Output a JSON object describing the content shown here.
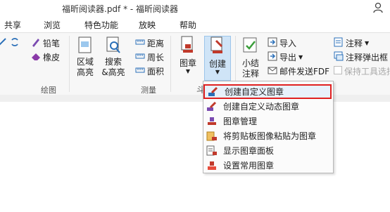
{
  "window": {
    "title": "福昕阅读器.pdf * - 福昕阅读器"
  },
  "menu": {
    "tabs": [
      "共享",
      "浏览",
      "特色功能",
      "放映",
      "帮助"
    ]
  },
  "ribbon": {
    "draw_group": {
      "pencil": "铅笔",
      "eraser": "橡皮",
      "label": "绘图"
    },
    "measure_group": {
      "area_highlight": [
        "区域",
        "高亮"
      ],
      "search_highlight": [
        "搜索",
        "&高亮"
      ],
      "distance": "距离",
      "perimeter": "周长",
      "area": "面积",
      "label": "测量"
    },
    "stamp_group": {
      "stamp": "图章",
      "create": "创建"
    },
    "comment_group": {
      "summary": [
        "小结",
        "注释"
      ],
      "import": "导入",
      "export": "导出",
      "email_fdf": "邮件发送FDF",
      "annotation": "注释",
      "annotation_popup": "注释弹出框",
      "keep_tool": "保持工具选择"
    }
  },
  "dropdown": {
    "fragment": "斗",
    "items": [
      {
        "label": "创建自定义图章",
        "icon": "stamp-pen-icon"
      },
      {
        "label": "创建自定义动态图章",
        "icon": "dynamic-stamp-icon"
      },
      {
        "label": "图章管理",
        "icon": "stamp-manage-icon"
      },
      {
        "label": "将剪贴板图像粘贴为图章",
        "icon": "clipboard-stamp-icon"
      },
      {
        "label": "显示图章面板",
        "icon": "stamp-panel-icon"
      },
      {
        "label": "设置常用图章",
        "icon": "favorite-stamp-icon"
      }
    ],
    "highlight_color": "#e02020"
  }
}
